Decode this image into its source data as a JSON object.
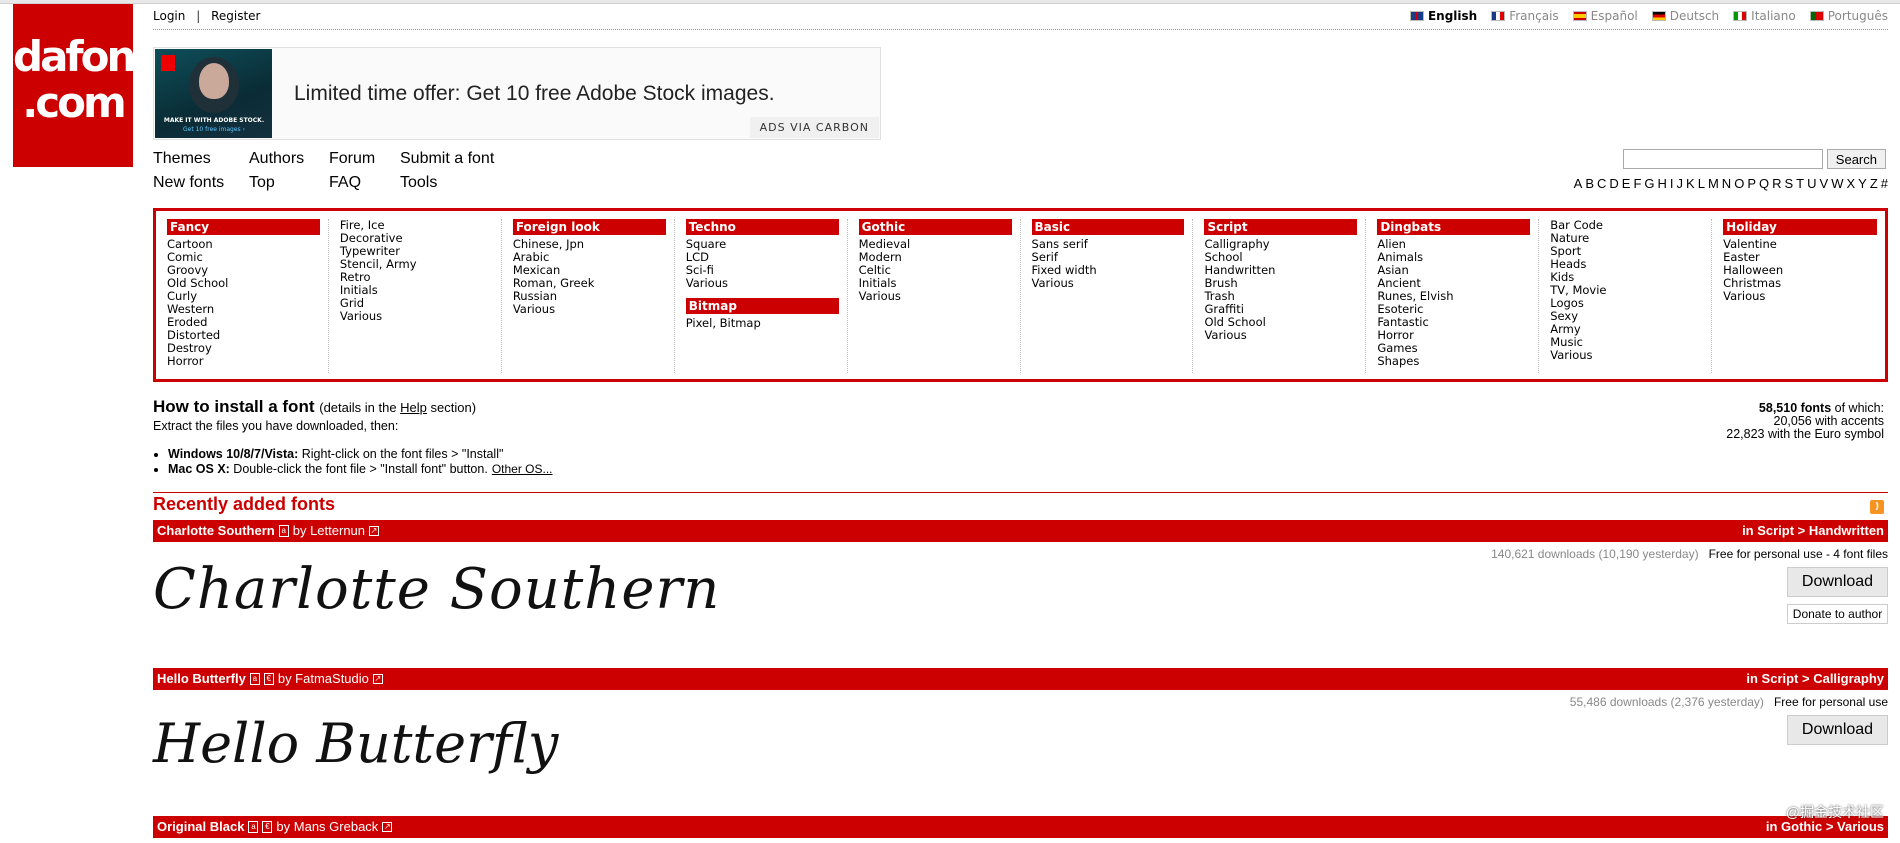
{
  "logo": {
    "line1": "dafont",
    "line2": ".com"
  },
  "auth": {
    "login": "Login",
    "sep": "|",
    "register": "Register"
  },
  "languages": [
    {
      "label": "English",
      "flag": "uk",
      "active": true
    },
    {
      "label": "Français",
      "flag": "fr",
      "active": false
    },
    {
      "label": "Español",
      "flag": "es",
      "active": false
    },
    {
      "label": "Deutsch",
      "flag": "de",
      "active": false
    },
    {
      "label": "Italiano",
      "flag": "it",
      "active": false
    },
    {
      "label": "Português",
      "flag": "pt",
      "active": false
    }
  ],
  "ad": {
    "caption1": "MAKE IT WITH ADOBE STOCK.",
    "caption2": "Get 10 free images ›",
    "text": "Limited time offer: Get 10 free Adobe Stock images.",
    "via": "ADS VIA CARBON"
  },
  "nav": {
    "row1": [
      "Themes",
      "Authors",
      "Forum",
      "Submit a font"
    ],
    "row2": [
      "New fonts",
      "Top",
      "FAQ",
      "Tools"
    ]
  },
  "search": {
    "value": "",
    "button": "Search"
  },
  "alphabet": [
    "A",
    "B",
    "C",
    "D",
    "E",
    "F",
    "G",
    "H",
    "I",
    "J",
    "K",
    "L",
    "M",
    "N",
    "O",
    "P",
    "Q",
    "R",
    "S",
    "T",
    "U",
    "V",
    "W",
    "X",
    "Y",
    "Z",
    "#"
  ],
  "categories": [
    {
      "head": "Fancy",
      "items": [
        "Cartoon",
        "Comic",
        "Groovy",
        "Old School",
        "Curly",
        "Western",
        "Eroded",
        "Distorted",
        "Destroy",
        "Horror"
      ]
    },
    {
      "head": "",
      "items": [
        "Fire, Ice",
        "Decorative",
        "Typewriter",
        "Stencil, Army",
        "Retro",
        "Initials",
        "Grid",
        "Various"
      ]
    },
    {
      "head": "Foreign look",
      "items": [
        "Chinese, Jpn",
        "Arabic",
        "Mexican",
        "Roman, Greek",
        "Russian",
        "Various"
      ]
    },
    {
      "head": "Techno",
      "items": [
        "Square",
        "LCD",
        "Sci-fi",
        "Various"
      ],
      "sub_head": "Bitmap",
      "sub_items": [
        "Pixel, Bitmap"
      ]
    },
    {
      "head": "Gothic",
      "items": [
        "Medieval",
        "Modern",
        "Celtic",
        "Initials",
        "Various"
      ]
    },
    {
      "head": "Basic",
      "items": [
        "Sans serif",
        "Serif",
        "Fixed width",
        "Various"
      ]
    },
    {
      "head": "Script",
      "items": [
        "Calligraphy",
        "School",
        "Handwritten",
        "Brush",
        "Trash",
        "Graffiti",
        "Old School",
        "Various"
      ]
    },
    {
      "head": "Dingbats",
      "items": [
        "Alien",
        "Animals",
        "Asian",
        "Ancient",
        "Runes, Elvish",
        "Esoteric",
        "Fantastic",
        "Horror",
        "Games",
        "Shapes"
      ]
    },
    {
      "head": "",
      "items": [
        "Bar Code",
        "Nature",
        "Sport",
        "Heads",
        "Kids",
        "TV, Movie",
        "Logos",
        "Sexy",
        "Army",
        "Music",
        "Various"
      ]
    },
    {
      "head": "Holiday",
      "items": [
        "Valentine",
        "Easter",
        "Halloween",
        "Christmas",
        "Various"
      ]
    }
  ],
  "install": {
    "title": "How to install a font",
    "details_pre": "(details in the ",
    "details_link": "Help",
    "details_post": " section)",
    "extract": "Extract the files you have downloaded, then:",
    "win_label": "Windows 10/8/7/Vista:",
    "win_text": " Right-click on the font files > \"Install\"",
    "mac_label": "Mac OS X:",
    "mac_text": " Double-click the font file > \"Install font\" button.",
    "other": "Other OS..."
  },
  "stats": {
    "count": "58,510 fonts",
    "of_which": " of which:",
    "accents": "20,056 with accents",
    "euro": "22,823 with the Euro symbol"
  },
  "recent_title": "Recently added fonts",
  "fonts": [
    {
      "name": "Charlotte Southern",
      "by": "by Letternun",
      "category": "in Script > Handwritten",
      "downloads": "140,621 downloads (10,190 yesterday)",
      "license": "Free for personal use - 4 font files",
      "preview": "Charlotte Southern",
      "download": "Download",
      "donate": "Donate to author"
    },
    {
      "name": "Hello Butterfly",
      "by": "by FatmaStudio",
      "category": "in Script > Calligraphy",
      "downloads": "55,486 downloads (2,376 yesterday)",
      "license": "Free for personal use",
      "preview": "Hello Butterfly",
      "download": "Download"
    },
    {
      "name": "Original Black",
      "by": "by Mans Greback",
      "category": "in Gothic > Various"
    }
  ],
  "watermark": "@掘金技术社区",
  "colors": {
    "brand": "#cc0000",
    "rss": "#f79421"
  }
}
